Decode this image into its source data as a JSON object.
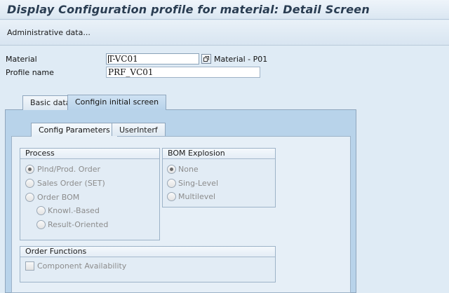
{
  "window": {
    "title": "Display Configuration profile for material: Detail Screen"
  },
  "toolbar": {
    "administrative_data": "Administrative data..."
  },
  "header_fields": {
    "material_label": "Material",
    "material_value": "T-VC01",
    "material_description": "Material  - P01",
    "profile_name_label": "Profile name",
    "profile_name_value": "PRF_VC01"
  },
  "tabs": {
    "outer": [
      {
        "label": "Basic data",
        "active": false
      },
      {
        "label": "Configin initial screen",
        "active": true
      }
    ],
    "inner": [
      {
        "label": "Config Parameters",
        "active": true
      },
      {
        "label": "UserInterf",
        "active": false
      }
    ]
  },
  "process_group": {
    "title": "Process",
    "options": [
      {
        "label": "Plnd/Prod. Order",
        "checked": true
      },
      {
        "label": "Sales Order (SET)",
        "checked": false
      },
      {
        "label": "Order BOM",
        "checked": false
      },
      {
        "label": "Knowl.-Based",
        "checked": false
      },
      {
        "label": "Result-Oriented",
        "checked": false
      }
    ]
  },
  "bom_group": {
    "title": "BOM Explosion",
    "options": [
      {
        "label": "None",
        "checked": true
      },
      {
        "label": "Sing-Level",
        "checked": false
      },
      {
        "label": "Multilevel",
        "checked": false
      }
    ]
  },
  "order_functions_group": {
    "title": "Order Functions",
    "options": [
      {
        "label": "Component Availability",
        "checked": false
      }
    ]
  },
  "colors": {
    "background": "#dfebf5",
    "active_tab": "#b8d3ea",
    "inner_panel": "#e6eff7",
    "disabled_text": "#8c8c8c",
    "focus_marker": "#ee2222"
  }
}
